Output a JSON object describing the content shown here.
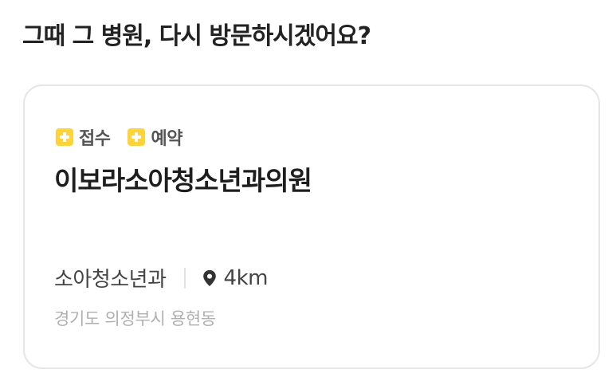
{
  "question": "그때 그 병원, 다시 방문하시겠어요?",
  "card": {
    "badges": [
      {
        "icon": "plus-square-icon",
        "label": "접수",
        "color": "#ffd43b"
      },
      {
        "icon": "plus-square-icon",
        "label": "예약",
        "color": "#ffd43b"
      }
    ],
    "clinic_name": "이보라소아청소년과의원",
    "department": "소아청소년과",
    "distance_icon": "location-pin-icon",
    "distance": "4km",
    "address": "경기도 의정부시 용현동"
  }
}
